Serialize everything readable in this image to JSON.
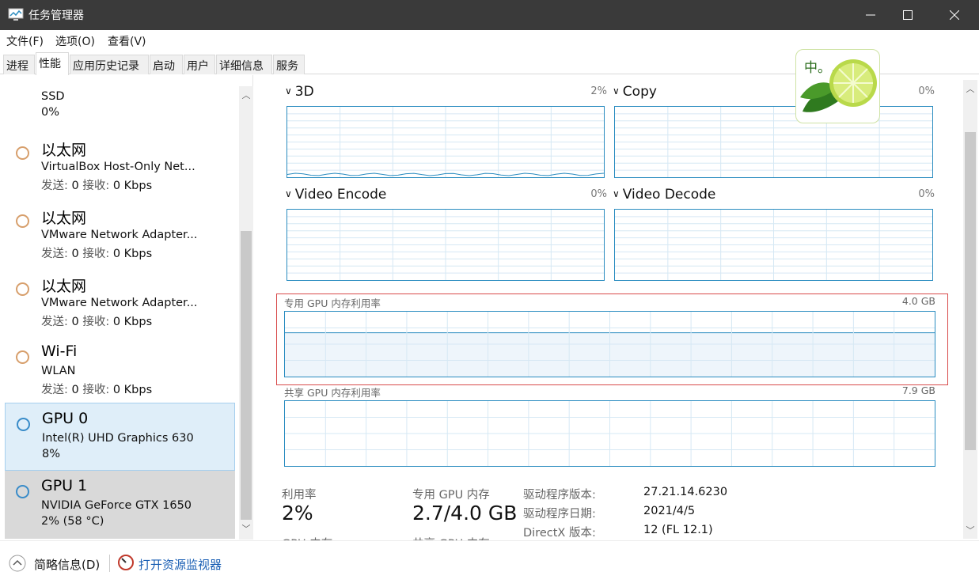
{
  "window": {
    "title": "任务管理器"
  },
  "menu": [
    "文件(F)",
    "选项(O)",
    "查看(V)"
  ],
  "tabs": [
    {
      "label": "进程",
      "active": false
    },
    {
      "label": "性能",
      "active": true
    },
    {
      "label": "应用历史记录",
      "active": false
    },
    {
      "label": "启动",
      "active": false
    },
    {
      "label": "用户",
      "active": false
    },
    {
      "label": "详细信息",
      "active": false
    },
    {
      "label": "服务",
      "active": false
    }
  ],
  "sidebar": {
    "partial_top": {
      "line1": "SSD",
      "line2": "0%"
    },
    "items": [
      {
        "name": "以太网",
        "sub": "VirtualBox Host-Only Net...",
        "send_label": "发送:",
        "send": "0",
        "recv_label": "接收:",
        "recv": "0 Kbps"
      },
      {
        "name": "以太网",
        "sub": "VMware Network Adapter...",
        "send_label": "发送:",
        "send": "0",
        "recv_label": "接收:",
        "recv": "0 Kbps"
      },
      {
        "name": "以太网",
        "sub": "VMware Network Adapter...",
        "send_label": "发送:",
        "send": "0",
        "recv_label": "接收:",
        "recv": "0 Kbps"
      },
      {
        "name": "Wi-Fi",
        "sub": "WLAN",
        "send_label": "发送:",
        "send": "0",
        "recv_label": "接收:",
        "recv": "0 Kbps"
      },
      {
        "name": "GPU 0",
        "sub": "Intel(R) UHD Graphics 630",
        "line2": "8%"
      },
      {
        "name": "GPU 1",
        "sub": "NVIDIA GeForce GTX 1650",
        "line2": "2% (58 °C)"
      }
    ]
  },
  "graphs": {
    "g3d": {
      "title": "3D",
      "pct": "2%"
    },
    "copy": {
      "title": "Copy",
      "pct": "0%"
    },
    "venc": {
      "title": "Video Encode",
      "pct": "0%"
    },
    "vdec": {
      "title": "Video Decode",
      "pct": "0%"
    },
    "dedicated": {
      "title": "专用 GPU 内存利用率",
      "max": "4.0 GB",
      "fill_fraction": 0.675
    },
    "shared": {
      "title": "共享 GPU 内存利用率",
      "max": "7.9 GB"
    }
  },
  "stats": {
    "util_label": "利用率",
    "util_value": "2%",
    "dedicated_label": "专用 GPU 内存",
    "dedicated_value": "2.7/4.0 GB",
    "partial_label_1": "GPU 内存",
    "partial_label_2": "共享 GPU 内存"
  },
  "info": [
    {
      "label": "驱动程序版本:",
      "value": "27.21.14.6230"
    },
    {
      "label": "驱动程序日期:",
      "value": "2021/4/5"
    },
    {
      "label": "DirectX 版本:",
      "value": "12 (FL 12.1)"
    }
  ],
  "bottom": {
    "summary": "简略信息(D)",
    "monitor": "打开资源监视器"
  },
  "ime": {
    "text": "中。,"
  },
  "colors": {
    "accent": "#2a8cc0",
    "title_bar": "#3a3a3a",
    "highlight": "#d84a4a"
  }
}
